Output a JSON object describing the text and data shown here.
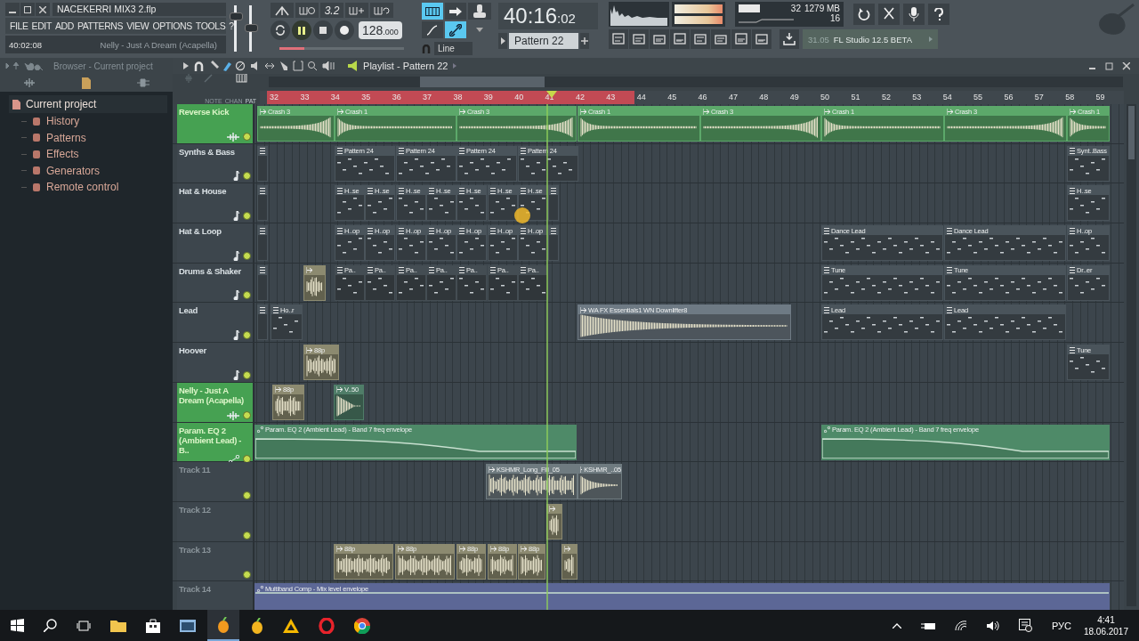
{
  "window": {
    "title": "NACEKERRI MIX3 2.flp"
  },
  "menu": [
    "FILE",
    "EDIT",
    "ADD",
    "PATTERNS",
    "VIEW",
    "OPTIONS",
    "TOOLS",
    "?"
  ],
  "hint_bar": {
    "time": "40:02:08",
    "text": "Nelly - Just A Dream (Acapella)"
  },
  "master_volume": {
    "level": 0.8
  },
  "master_pitch": {
    "level": 0.5
  },
  "transport": {
    "playing": true,
    "step_label": "3.2",
    "tempo": "128",
    "tempo_fraction": ".000",
    "snap": "Line",
    "position": {
      "level": 0.2
    }
  },
  "song_time": {
    "main": "40:16",
    "ticks": ":02"
  },
  "pattern_selector": "Pattern 22",
  "cpu_panel": {
    "cpu": "32",
    "memory": "1279 MB",
    "polyphony": "16"
  },
  "news": {
    "date": "31.05",
    "text": "FL Studio 12.5 BETA"
  },
  "browser": {
    "title": "Browser - Current project",
    "tree": [
      {
        "label": "Current project",
        "children": [
          {
            "label": "History"
          },
          {
            "label": "Patterns"
          },
          {
            "label": "Effects"
          },
          {
            "label": "Generators"
          },
          {
            "label": "Remote control"
          }
        ]
      }
    ]
  },
  "playlist": {
    "title": "Playlist - Pattern 22",
    "header_labels": [
      "NOTE",
      "CHAN",
      "PAT"
    ],
    "ruler": [
      {
        "label": "32",
        "selected": true
      },
      {
        "label": "33",
        "selected": true
      },
      {
        "label": "34",
        "selected": true
      },
      {
        "label": "35",
        "selected": true
      },
      {
        "label": "36",
        "selected": true
      },
      {
        "label": "37",
        "selected": true
      },
      {
        "label": "38",
        "selected": true
      },
      {
        "label": "39",
        "selected": true
      },
      {
        "label": "40",
        "selected": true
      },
      {
        "label": "41",
        "selected": true
      },
      {
        "label": "42",
        "selected": true
      },
      {
        "label": "43",
        "selected": true
      },
      {
        "label": "44",
        "selected": false
      },
      {
        "label": "45",
        "selected": false
      },
      {
        "label": "46",
        "selected": false
      },
      {
        "label": "47",
        "selected": false
      },
      {
        "label": "48",
        "selected": false
      },
      {
        "label": "49",
        "selected": false
      },
      {
        "label": "50",
        "selected": false
      },
      {
        "label": "51",
        "selected": false
      },
      {
        "label": "52",
        "selected": false
      },
      {
        "label": "53",
        "selected": false
      },
      {
        "label": "54",
        "selected": false
      },
      {
        "label": "55",
        "selected": false
      },
      {
        "label": "56",
        "selected": false
      },
      {
        "label": "57",
        "selected": false
      },
      {
        "label": "58",
        "selected": false
      },
      {
        "label": "59",
        "selected": false
      }
    ],
    "tracks": [
      {
        "name": "Reverse Kick",
        "kind": "audio",
        "selected": true,
        "clips": [
          {
            "kind": "audio",
            "label": "Crash 3",
            "color": "#5ca86a"
          },
          {
            "kind": "audio",
            "label": "Crash 1",
            "color": "#5ca86a"
          },
          {
            "kind": "audio",
            "label": "Crash 3",
            "color": "#5ca86a"
          },
          {
            "kind": "audio",
            "label": "Crash 1",
            "color": "#5ca86a"
          },
          {
            "kind": "audio",
            "label": "Crash 3",
            "color": "#5ca86a"
          },
          {
            "kind": "audio",
            "label": "Crash 1",
            "color": "#5ca86a"
          },
          {
            "kind": "audio",
            "label": "Crash 3",
            "color": "#5ca86a"
          },
          {
            "kind": "audio",
            "label": "Crash 1",
            "color": "#5ca86a"
          }
        ]
      },
      {
        "name": "Synths & Bass",
        "kind": "pattern",
        "selected": false,
        "clips": [
          {
            "kind": "pattern",
            "color": "#4a545b"
          },
          {
            "kind": "pattern",
            "label": "Pattern 24",
            "color": "#4a545b"
          },
          {
            "kind": "pattern",
            "label": "Pattern 24",
            "color": "#4a545b"
          },
          {
            "kind": "pattern",
            "label": "Pattern 24",
            "color": "#4a545b"
          },
          {
            "kind": "pattern",
            "label": "Pattern 24",
            "color": "#4a545b"
          },
          {
            "kind": "pattern",
            "label": "Synt..Bass",
            "color": "#4a545b"
          }
        ]
      },
      {
        "name": "Hat & House",
        "kind": "pattern",
        "selected": false,
        "clips": [
          {
            "kind": "pattern",
            "color": "#4a545b"
          },
          {
            "kind": "pattern",
            "label": "H..se",
            "color": "#4a545b"
          },
          {
            "kind": "pattern",
            "label": "H..se",
            "color": "#4a545b"
          },
          {
            "kind": "pattern",
            "label": "H..se",
            "color": "#4a545b"
          },
          {
            "kind": "pattern",
            "label": "H..se",
            "color": "#4a545b"
          },
          {
            "kind": "pattern",
            "label": "H..se",
            "color": "#4a545b"
          },
          {
            "kind": "pattern",
            "label": "H..se",
            "color": "#4a545b"
          },
          {
            "kind": "pattern",
            "label": "H..se",
            "color": "#4a545b"
          },
          {
            "kind": "pattern",
            "color": "#4a545b"
          },
          {
            "kind": "pattern",
            "label": "H..se",
            "color": "#4a545b"
          }
        ]
      },
      {
        "name": "Hat & Loop",
        "kind": "pattern",
        "selected": false,
        "clips": [
          {
            "kind": "pattern",
            "color": "#4a545b"
          },
          {
            "kind": "pattern",
            "label": "H..op",
            "color": "#4a545b"
          },
          {
            "kind": "pattern",
            "label": "H..op",
            "color": "#4a545b"
          },
          {
            "kind": "pattern",
            "label": "H..op",
            "color": "#4a545b"
          },
          {
            "kind": "pattern",
            "label": "H..op",
            "color": "#4a545b"
          },
          {
            "kind": "pattern",
            "label": "H..op",
            "color": "#4a545b"
          },
          {
            "kind": "pattern",
            "label": "H..op",
            "color": "#4a545b"
          },
          {
            "kind": "pattern",
            "label": "H..op",
            "color": "#4a545b"
          },
          {
            "kind": "pattern",
            "color": "#4a545b"
          },
          {
            "kind": "pattern",
            "label": "Dance Lead",
            "color": "#4a545b"
          },
          {
            "kind": "pattern",
            "label": "Dance Lead",
            "color": "#4a545b"
          },
          {
            "kind": "pattern",
            "label": "H..op",
            "color": "#4a545b"
          }
        ]
      },
      {
        "name": "Drums & Shaker",
        "kind": "pattern",
        "selected": false,
        "clips": [
          {
            "kind": "pattern",
            "color": "#4a545b"
          },
          {
            "kind": "audio",
            "color": "#8c8a70"
          },
          {
            "kind": "pattern",
            "label": "Pa..",
            "color": "#444d53"
          },
          {
            "kind": "pattern",
            "label": "Pa..",
            "color": "#444d53"
          },
          {
            "kind": "pattern",
            "label": "Pa..",
            "color": "#444d53"
          },
          {
            "kind": "pattern",
            "label": "Pa..",
            "color": "#444d53"
          },
          {
            "kind": "pattern",
            "label": "Pa..",
            "color": "#444d53"
          },
          {
            "kind": "pattern",
            "label": "Pa..",
            "color": "#444d53"
          },
          {
            "kind": "pattern",
            "label": "Pa..",
            "color": "#444d53"
          },
          {
            "kind": "pattern",
            "label": "Tune",
            "color": "#4a545b"
          },
          {
            "kind": "pattern",
            "label": "Tune",
            "color": "#4a545b"
          },
          {
            "kind": "pattern",
            "label": "Dr..er",
            "color": "#4a545b"
          }
        ]
      },
      {
        "name": "Lead",
        "kind": "pattern",
        "selected": false,
        "clips": [
          {
            "kind": "pattern",
            "color": "#4a545b"
          },
          {
            "kind": "pattern",
            "label": "Ho..r",
            "color": "#4a545b"
          },
          {
            "kind": "audio",
            "label": "WA FX Essentials1 WN Downlifter8",
            "color": "#6e7a84"
          },
          {
            "kind": "pattern",
            "label": "Lead",
            "color": "#4a545b"
          },
          {
            "kind": "pattern",
            "label": "Lead",
            "color": "#4a545b"
          }
        ]
      },
      {
        "name": "Hoover",
        "kind": "pattern",
        "selected": false,
        "clips": [
          {
            "kind": "audio",
            "label": "88p",
            "color": "#8c8a70"
          },
          {
            "kind": "pattern",
            "label": "Tune",
            "color": "#4a545b"
          }
        ]
      },
      {
        "name": "Nelly - Just A Dream (Acapella)",
        "kind": "audio",
        "selected": true,
        "clips": [
          {
            "kind": "audio",
            "label": "88p",
            "color": "#8c8a70"
          },
          {
            "kind": "audio",
            "label": "V..50",
            "color": "#4f7d68"
          }
        ]
      },
      {
        "name": "Param. EQ 2 (Ambient Lead) - B..",
        "kind": "automation",
        "selected": true,
        "clips": [
          {
            "kind": "automation",
            "label": "Param. EQ 2 (Ambient Lead) - Band 7 freq envelope",
            "color": "#4e8a68"
          },
          {
            "kind": "automation",
            "label": "Param. EQ 2 (Ambient Lead) - Band 7 freq envelope",
            "color": "#4e8a68"
          }
        ]
      },
      {
        "name": "Track 11",
        "kind": "empty",
        "selected": false,
        "clips": [
          {
            "kind": "audio",
            "label": "KSHMR_Long_Fill_05",
            "color": "#6f7b80"
          },
          {
            "kind": "audio",
            "label": "KSHMR_..05",
            "color": "#6f7b80"
          }
        ]
      },
      {
        "name": "Track 12",
        "kind": "empty",
        "selected": false,
        "clips": [
          {
            "kind": "audio",
            "color": "#8c8a70"
          }
        ]
      },
      {
        "name": "Track 13",
        "kind": "empty",
        "selected": false,
        "clips": [
          {
            "kind": "audio",
            "label": "88p",
            "color": "#8c8a70"
          },
          {
            "kind": "audio",
            "label": "88p",
            "color": "#8c8a70"
          },
          {
            "kind": "audio",
            "label": "88p",
            "color": "#8c8a70"
          },
          {
            "kind": "audio",
            "label": "88p",
            "color": "#8c8a70"
          },
          {
            "kind": "audio",
            "label": "88p",
            "color": "#8c8a70"
          },
          {
            "kind": "audio",
            "color": "#8c8a70"
          }
        ]
      },
      {
        "name": "Track 14",
        "kind": "empty",
        "selected": false,
        "clips": [
          {
            "kind": "automation",
            "label": "Multiband Comp - Mix level envelope",
            "color": "#5c6796"
          }
        ]
      }
    ]
  },
  "taskbar": {
    "language": "РУС",
    "time": "4:41",
    "date": "18.06.2017"
  }
}
